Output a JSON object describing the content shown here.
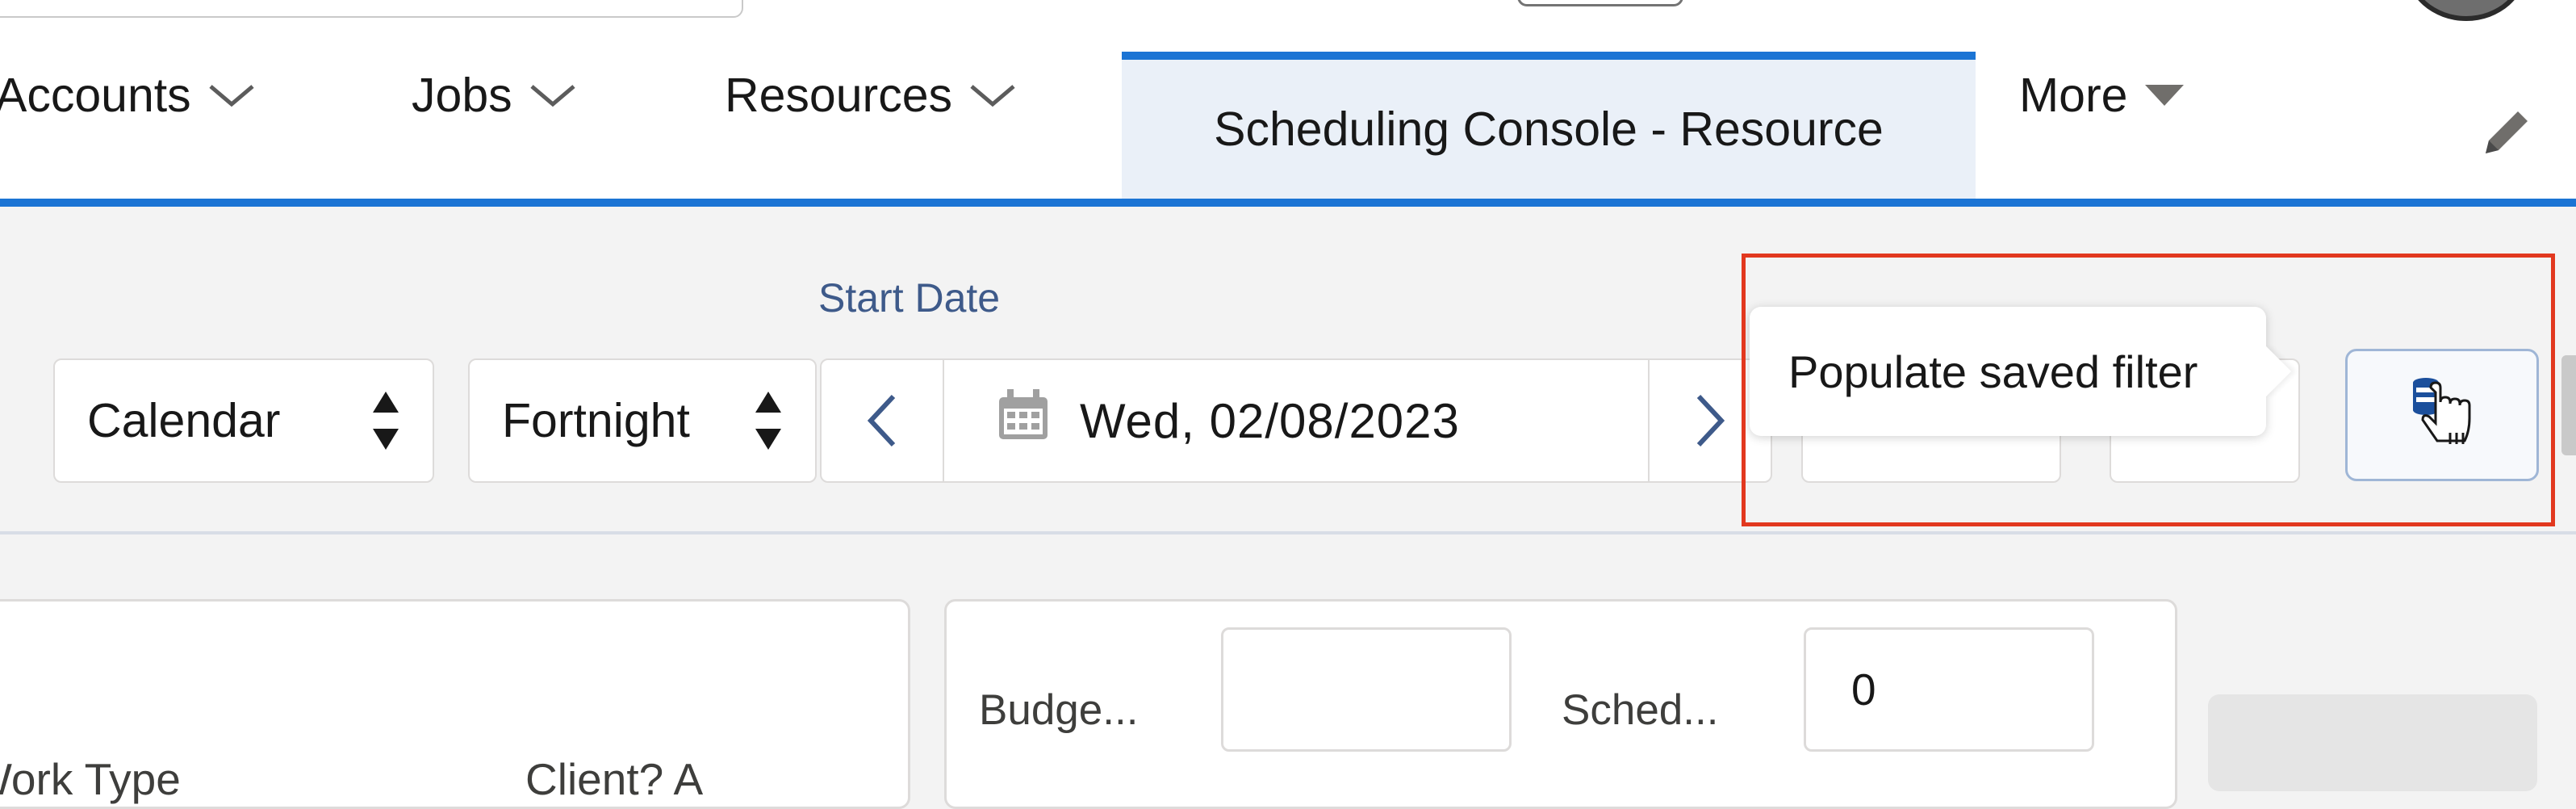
{
  "nav": {
    "items": [
      {
        "label": "Accounts",
        "has_dropdown": true
      },
      {
        "label": "Jobs",
        "has_dropdown": true
      },
      {
        "label": "Resources",
        "has_dropdown": true
      }
    ],
    "active_tab": "Scheduling Console - Resource",
    "more_label": "More"
  },
  "toolbar": {
    "view_select": "Calendar",
    "period_select": "Fortnight",
    "start_date_label": "Start Date",
    "start_date_value": "Wed, 02/08/2023",
    "tooltip": "Populate saved filter"
  },
  "fields": {
    "budget_label": "Budge...",
    "budget_value": "",
    "scheduled_label": "Sched...",
    "scheduled_value": "0"
  },
  "bottom_cut": {
    "left_text": "Work Type",
    "right_text": "Client? A"
  },
  "colors": {
    "accent": "#1b74d4",
    "highlight": "#e2381f",
    "active_tab_bg": "#eaf0f8"
  },
  "icons": {
    "calendar": "calendar-icon",
    "edit": "pencil-icon",
    "saved_filter": "database-icon",
    "cursor": "hand-cursor-icon"
  }
}
